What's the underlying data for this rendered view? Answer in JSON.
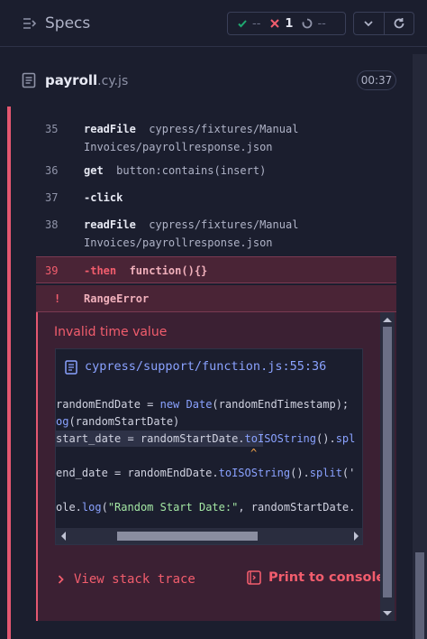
{
  "header": {
    "title": "Specs",
    "stats": {
      "passed_icon": "check-icon",
      "passed": "--",
      "failed_icon": "x-icon",
      "failed": "1",
      "pending_icon": "spinner-icon",
      "pending": "--"
    },
    "controls": [
      "chevron-down-icon",
      "reload-icon"
    ]
  },
  "spec": {
    "name": "payroll",
    "ext": ".cy.js",
    "duration": "00:37"
  },
  "commands": [
    {
      "num": "35",
      "name": "readFile",
      "msg": "cypress/fixtures/Manual",
      "msg2": "Invoices/payrollresponse.json"
    },
    {
      "num": "36",
      "name": "get",
      "msg": "button:contains(insert)"
    },
    {
      "num": "37",
      "name": "-click",
      "msg": ""
    },
    {
      "num": "38",
      "name": "readFile",
      "msg": "cypress/fixtures/Manual",
      "msg2": "Invoices/payrollresponse.json"
    },
    {
      "num": "39",
      "name": "-then",
      "msg": "function(){}"
    }
  ],
  "error": {
    "bang": "!",
    "type": "RangeError",
    "message": "Invalid time value",
    "code_frame": {
      "file": "cypress/support/function.js:55:36",
      "lines": [
        "randomEndDate = new Date(randomEndTimestamp);",
        "og(randomStartDate)",
        "start_date = randomStartDate.toISOString().spl",
        "",
        "end_date = randomEndDate.toISOString().split('",
        "",
        "ole.log(\"Random Start Date:\", randomStartDate."
      ],
      "caret": "^"
    },
    "stack_trace_label": "View stack trace",
    "print_label": "Print to console"
  },
  "colors": {
    "accent_fail": "#f25d6d",
    "accent_pass": "#1fa971",
    "link_blue": "#8aa2ff",
    "background": "#1b1e2e"
  }
}
